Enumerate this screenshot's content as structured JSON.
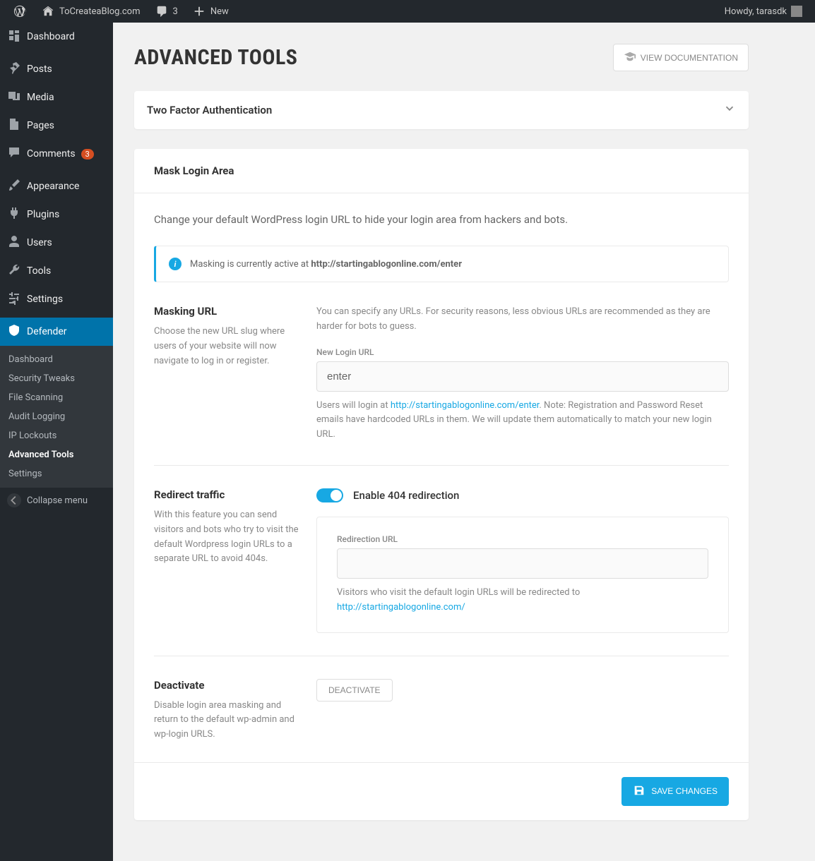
{
  "adminbar": {
    "site_name": "ToCreateaBlog.com",
    "comments_count": "3",
    "new_label": "New",
    "howdy": "Howdy, tarasdk"
  },
  "sidebar": {
    "items": [
      {
        "label": "Dashboard"
      },
      {
        "label": "Posts"
      },
      {
        "label": "Media"
      },
      {
        "label": "Pages"
      },
      {
        "label": "Comments",
        "badge": "3"
      },
      {
        "label": "Appearance"
      },
      {
        "label": "Plugins"
      },
      {
        "label": "Users"
      },
      {
        "label": "Tools"
      },
      {
        "label": "Settings"
      },
      {
        "label": "Defender"
      }
    ],
    "submenu": [
      {
        "label": "Dashboard"
      },
      {
        "label": "Security Tweaks"
      },
      {
        "label": "File Scanning"
      },
      {
        "label": "Audit Logging"
      },
      {
        "label": "IP Lockouts"
      },
      {
        "label": "Advanced Tools"
      },
      {
        "label": "Settings"
      }
    ],
    "collapse": "Collapse menu"
  },
  "page": {
    "title": "ADVANCED TOOLS",
    "doc_btn": "VIEW DOCUMENTATION",
    "accordion_title": "Two Factor Authentication",
    "panel_title": "Mask Login Area",
    "description": "Change your default WordPress login URL to hide your login area from hackers and bots.",
    "notice_prefix": "Masking is currently active at ",
    "notice_url": "http://startingablogonline.com/enter",
    "masking": {
      "title": "Masking URL",
      "desc": "Choose the new URL slug where users of your website will now navigate to log in or register.",
      "hint": "You can specify any URLs. For security reasons, less obvious URLs are recommended as they are harder for bots to guess.",
      "label": "New Login URL",
      "value": "enter",
      "under_pre": "Users will login at ",
      "under_url": "http://startingablogonline.com/enter",
      "under_post": ". Note: Registration and Password Reset emails have hardcoded URLs in them. We will update them automatically to match your new login URL."
    },
    "redirect": {
      "title": "Redirect traffic",
      "desc": "With this feature you can send visitors and bots who try to visit the default Wordpress login URLs to a separate URL to avoid 404s.",
      "toggle_label": "Enable 404 redirection",
      "box_label": "Redirection URL",
      "box_value": "",
      "under_pre": "Visitors who visit the default login URLs will be redirected to ",
      "under_url": "http://startingablogonline.com/"
    },
    "deactivate": {
      "title": "Deactivate",
      "desc": "Disable login area masking and return to the default wp-admin and wp-login URLS.",
      "btn": "DEACTIVATE"
    },
    "save": "SAVE CHANGES"
  }
}
